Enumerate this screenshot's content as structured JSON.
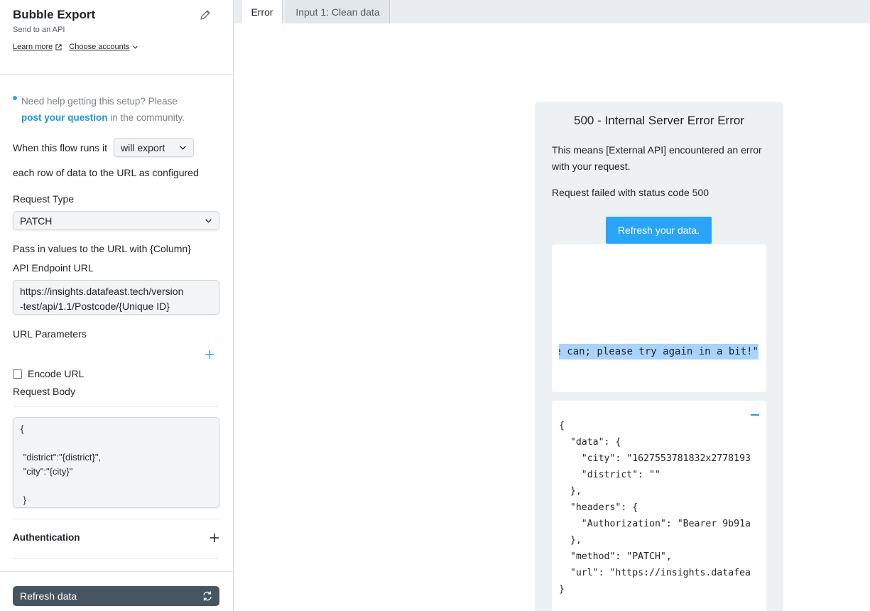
{
  "sidebar": {
    "title": "Bubble Export",
    "subtitle": "Send to an API",
    "learn_more": "Learn more",
    "choose_accounts": "Choose accounts",
    "help_text": "Need help getting this setup? Please",
    "help_link": "post your question",
    "help_suffix": " in the community.",
    "flow_prefix": "When this flow runs it",
    "flow_mode": "will export",
    "flow_suffix": "each row of data to the URL as configured",
    "request_type_label": "Request Type",
    "request_type_value": "PATCH",
    "pass_values_label": "Pass in values to the URL with {Column}",
    "endpoint_label": "API Endpoint URL",
    "endpoint_line1": "https://insights.datafeast.tech/version",
    "endpoint_line2": "-test/api/1.1/Postcode/{Unique ID}",
    "url_params_label": "URL Parameters",
    "encode_url_label": "Encode URL",
    "encode_url_checked": false,
    "request_body_label": "Request Body",
    "request_body": "{\n\n \"district\":\"{district}\",\n \"city\":\"{city}\"\n\n }",
    "auth_label": "Authentication",
    "refresh_label": "Refresh data"
  },
  "tabs": [
    {
      "label": "Error",
      "active": true
    },
    {
      "label": "Input 1: Clean data",
      "active": false
    }
  ],
  "error": {
    "title": "500 - Internal Server Error Error",
    "description": "This means [External API] encountered an error with your request.",
    "status_text": "Request failed with status code 500",
    "button_label": "Refresh your data.",
    "response_message": "e can; please try again in a bit!\"",
    "request_json": "{\n  \"data\": {\n    \"city\": \"1627553781832x2778193\n    \"district\": \"\"\n  },\n  \"headers\": {\n    \"Authorization\": \"Bearer 9b91a\n  },\n  \"method\": \"PATCH\",\n  \"url\": \"https://insights.datafea\n}"
  },
  "colors": {
    "accent": "#2aa5f5",
    "link": "#1d96e0",
    "selection": "#a9d3fb",
    "refresh_button": "#46555f"
  },
  "icons": {
    "edit": "pencil-icon",
    "external": "external-link-icon",
    "chevron": "chevron-down-icon",
    "add": "plus-icon",
    "refresh": "refresh-icon",
    "collapse": "minus-icon"
  }
}
